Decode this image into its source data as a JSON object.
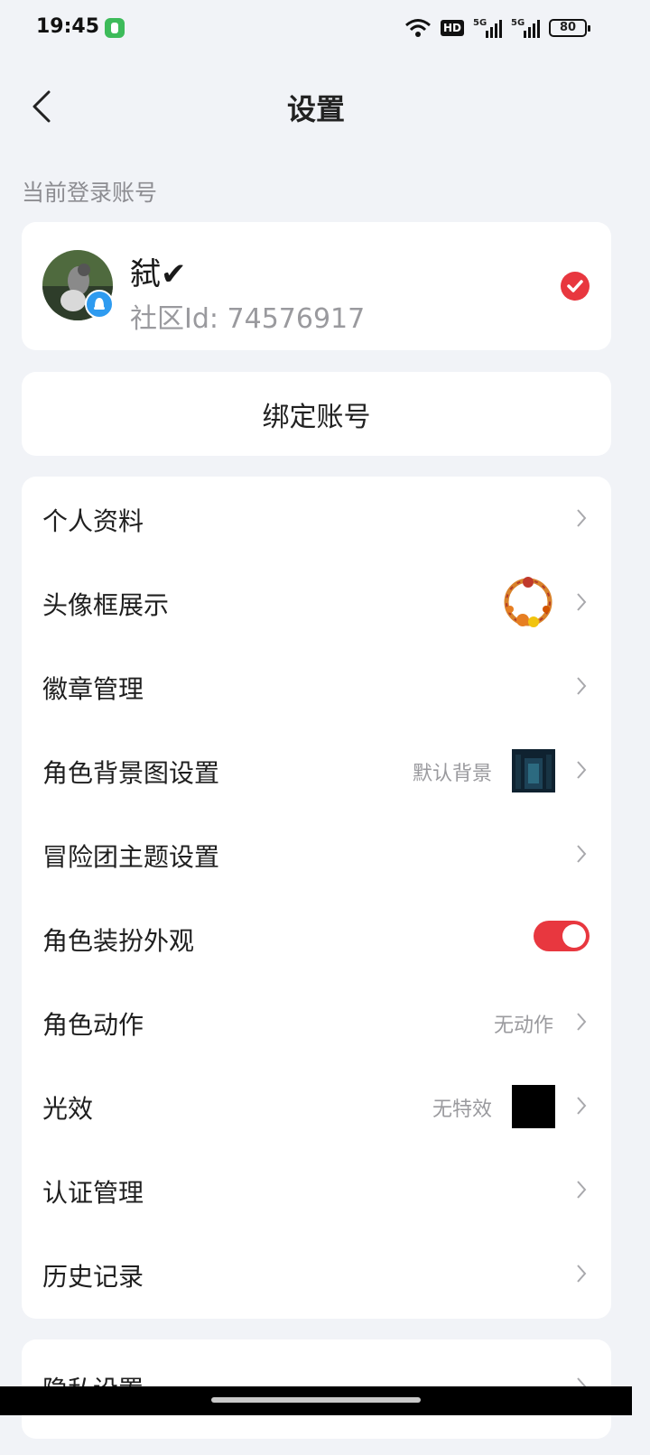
{
  "status_bar": {
    "time": "19:45",
    "hd_label": "HD",
    "sim1_label": "5G",
    "sim2_label": "5G",
    "battery": "80"
  },
  "header": {
    "title": "设置"
  },
  "account_section": {
    "label": "当前登录账号",
    "name": "弑✔",
    "community_id": "社区Id: 74576917"
  },
  "bind_account": {
    "label": "绑定账号"
  },
  "menu": {
    "items": [
      {
        "label": "个人资料"
      },
      {
        "label": "头像框展示"
      },
      {
        "label": "徽章管理"
      },
      {
        "label": "角色背景图设置",
        "value": "默认背景"
      },
      {
        "label": "冒险团主题设置"
      },
      {
        "label": "角色装扮外观",
        "toggle": true
      },
      {
        "label": "角色动作",
        "value": "无动作"
      },
      {
        "label": "光效",
        "value": "无特效"
      },
      {
        "label": "认证管理"
      },
      {
        "label": "历史记录"
      }
    ]
  },
  "privacy": {
    "label": "隐私设置"
  },
  "colors": {
    "accent": "#e8373f",
    "background": "#f1f3f7",
    "card": "#ffffff",
    "secondary_text": "#9a9a9e"
  },
  "icons": [
    "wifi-icon",
    "signal-icon",
    "battery-icon",
    "back-arrow-icon",
    "checkmark-icon",
    "chevron-right-icon",
    "qq-badge-icon"
  ]
}
